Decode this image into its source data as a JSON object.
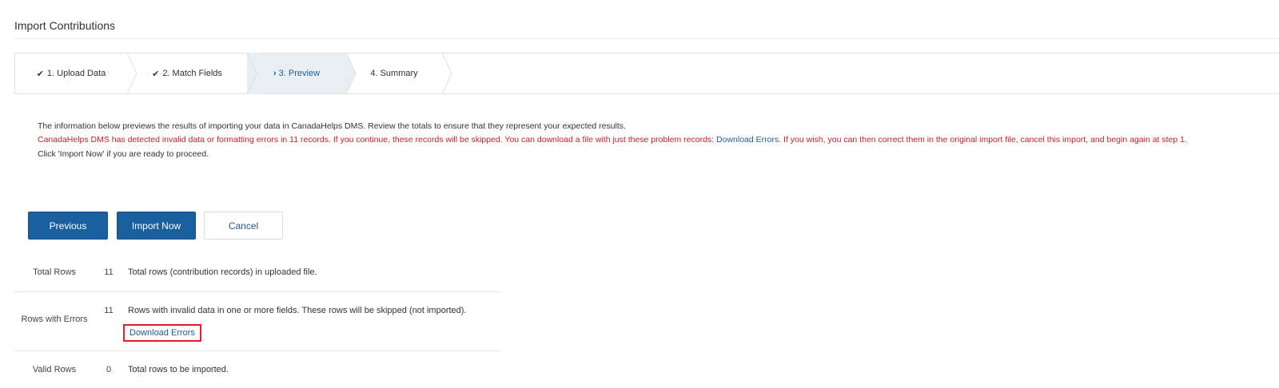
{
  "page": {
    "title": "Import Contributions"
  },
  "wizard": {
    "steps": [
      {
        "label": "1. Upload Data",
        "state": "done",
        "icon": "check-icon"
      },
      {
        "label": "2. Match Fields",
        "state": "done",
        "icon": "check-icon"
      },
      {
        "label": "3. Preview",
        "state": "active",
        "icon": "chevron-right-icon"
      },
      {
        "label": "4. Summary",
        "state": "pending"
      }
    ]
  },
  "info": {
    "line1": "The information below previews the results of importing your data in CanadaHelps DMS. Review the totals to ensure that they represent your expected results.",
    "line2_before": "CanadaHelps DMS has detected invalid data or formatting errors in 11 records. If you continue, these records will be skipped. You can download a file with just these problem records: ",
    "line2_link": "Download Errors",
    "line2_after": ". If you wish, you can then correct them in the original import file, cancel this import, and begin again at step 1.",
    "line3": "Click 'Import Now' if you are ready to proceed."
  },
  "buttons": {
    "previous": "Previous",
    "import_now": "Import Now",
    "cancel": "Cancel"
  },
  "summary": {
    "rows": [
      {
        "label": "Total Rows",
        "count": "11",
        "description": "Total rows (contribution records) in uploaded file."
      },
      {
        "label": "Rows with Errors",
        "count": "11",
        "description": "Rows with invalid data in one or more fields. These rows will be skipped (not imported).",
        "link": "Download Errors"
      },
      {
        "label": "Valid Rows",
        "count": "0",
        "description": "Total rows to be imported."
      }
    ]
  },
  "colors": {
    "primary": "#1a5fa0",
    "error_text": "#c4202e",
    "link": "#1d5c99",
    "active_step_bg": "#e9eef2",
    "highlight_box": "#e01f26"
  }
}
